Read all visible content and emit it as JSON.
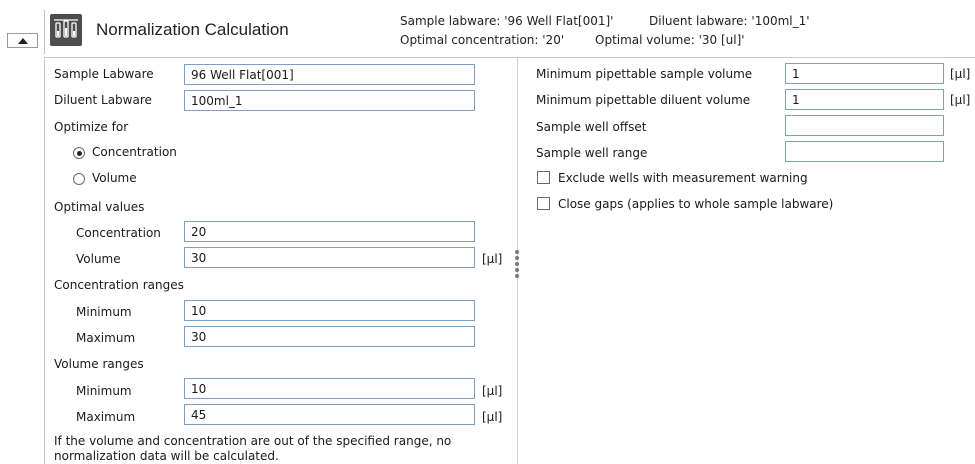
{
  "header": {
    "title": "Normalization Calculation",
    "sample_labware_summary": "Sample labware: '96 Well Flat[001]'",
    "diluent_labware_summary": "Diluent labware: '100ml_1'",
    "optimal_concentration_summary": "Optimal concentration: '20'",
    "optimal_volume_summary": "Optimal volume: '30 [ul]'"
  },
  "left": {
    "sample_labware_label": "Sample Labware",
    "sample_labware_value": "96 Well Flat[001]",
    "diluent_labware_label": "Diluent Labware",
    "diluent_labware_value": "100ml_1",
    "optimize_for_label": "Optimize for",
    "radio_concentration": "Concentration",
    "radio_volume": "Volume",
    "optimize_selected": "Concentration",
    "optimal_values_label": "Optimal values",
    "opt_concentration_label": "Concentration",
    "opt_concentration_value": "20",
    "opt_volume_label": "Volume",
    "opt_volume_value": "30",
    "opt_volume_unit": "[µl]",
    "concentration_ranges_label": "Concentration ranges",
    "conc_min_label": "Minimum",
    "conc_min_value": "10",
    "conc_max_label": "Maximum",
    "conc_max_value": "30",
    "volume_ranges_label": "Volume ranges",
    "vol_min_label": "Minimum",
    "vol_min_value": "10",
    "vol_min_unit": "[µl]",
    "vol_max_label": "Maximum",
    "vol_max_value": "45",
    "vol_max_unit": "[µl]",
    "note_line1": "If the volume and concentration are out of the specified range, no",
    "note_line2": "normalization data will be calculated."
  },
  "right": {
    "min_sample_label": "Minimum pipettable sample volume",
    "min_sample_value": "1",
    "min_sample_unit": "[µl]",
    "min_diluent_label": "Minimum pipettable diluent volume",
    "min_diluent_value": "1",
    "min_diluent_unit": "[µl]",
    "well_offset_label": "Sample well offset",
    "well_offset_value": "",
    "well_range_label": "Sample well range",
    "well_range_value": "",
    "exclude_warning_label": "Exclude wells with measurement warning",
    "exclude_warning_checked": false,
    "close_gaps_label": "Close gaps (applies to whole sample labware)",
    "close_gaps_checked": false
  },
  "colors": {
    "input_border": "#7f9fc0",
    "icon_bg": "#4d4d4d"
  }
}
